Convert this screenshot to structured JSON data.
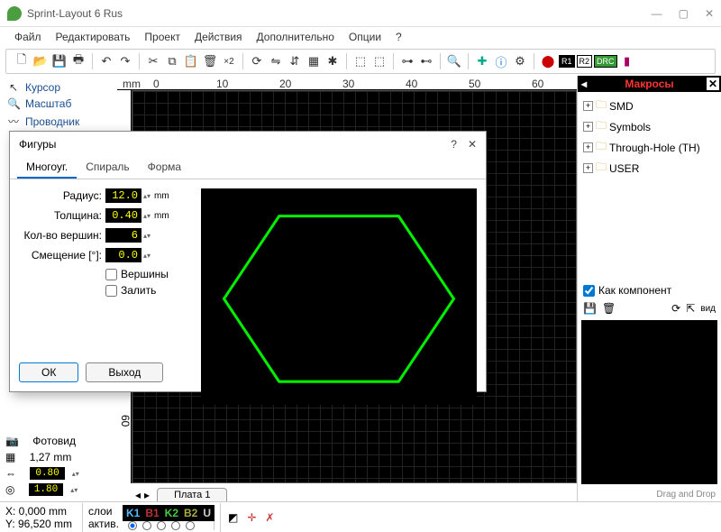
{
  "window": {
    "title": "Sprint-Layout 6 Rus"
  },
  "menu": [
    "Файл",
    "Редактировать",
    "Проект",
    "Действия",
    "Дополнительно",
    "Опции",
    "?"
  ],
  "tools": {
    "cursor": "Курсор",
    "zoom": "Масштаб",
    "track": "Проводник"
  },
  "left_bottom": {
    "photoview": "Фотовид",
    "grid": "1,27 mm",
    "val1": "0.80",
    "val2": "1.80"
  },
  "ruler": {
    "unit": "mm",
    "h": [
      "0",
      "10",
      "20",
      "30",
      "40",
      "50",
      "60"
    ],
    "v": [
      "60"
    ]
  },
  "board_tab": "Плата 1",
  "macros": {
    "title": "Макросы",
    "tree": [
      "SMD",
      "Symbols",
      "Through-Hole (TH)",
      "USER"
    ],
    "as_component": "Как компонент",
    "view_btn": "вид",
    "dragdrop": "Drag and Drop"
  },
  "dialog": {
    "title": "Фигуры",
    "tabs": [
      "Многоуг.",
      "Спираль",
      "Форма"
    ],
    "labels": {
      "radius": "Радиус:",
      "thickness": "Толщина:",
      "vertices": "Кол-во вершин:",
      "offset": "Смещение [°]:",
      "vert_chk": "Вершины",
      "fill_chk": "Залить"
    },
    "values": {
      "radius": "12.0",
      "thickness": "0.40",
      "vertices": "6",
      "offset": "0.0"
    },
    "unit_mm": "mm",
    "ok": "ОК",
    "cancel": "Выход"
  },
  "status": {
    "x": "X:   0,000 mm",
    "y": "Y:  96,520 mm",
    "layers_label": "слои",
    "activ_label": "актив.",
    "layers": [
      {
        "name": "K1",
        "color": "#5bf"
      },
      {
        "name": "B1",
        "color": "#b33"
      },
      {
        "name": "K2",
        "color": "#4c4"
      },
      {
        "name": "B2",
        "color": "#aa4"
      },
      {
        "name": "U",
        "color": "#ccc"
      }
    ]
  },
  "tb_badges": [
    "R1",
    "R2",
    "DRC"
  ]
}
